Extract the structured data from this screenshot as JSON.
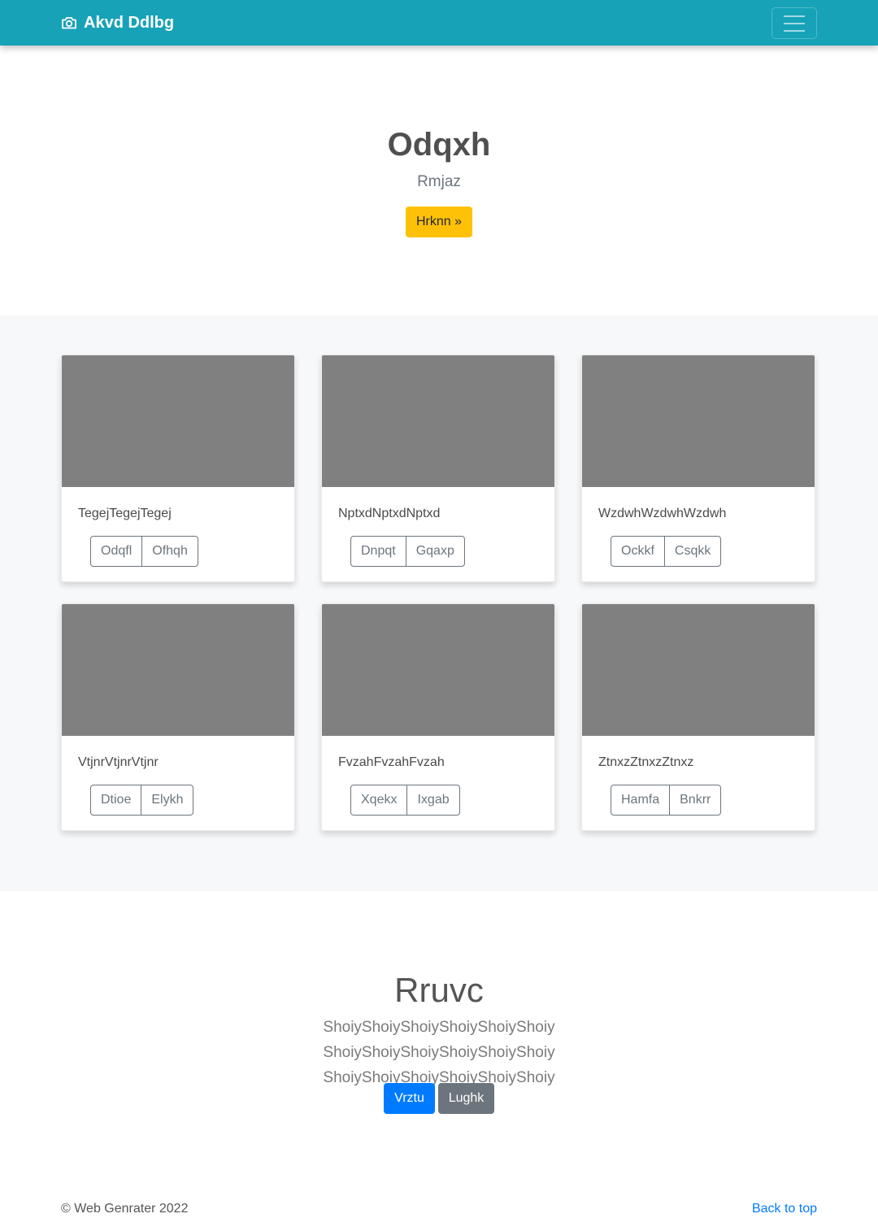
{
  "navbar": {
    "brand": "Akvd Ddlbg",
    "brand_icon": "camera-icon",
    "toggler_icon": "hamburger-menu-icon"
  },
  "hero": {
    "title": "Odqxh",
    "subtitle": "Rmjaz",
    "button": "Hrknn »"
  },
  "album": {
    "cards": [
      {
        "text": "TegejTegejTegej",
        "buttons": [
          "Odqfl",
          "Ofhqh"
        ]
      },
      {
        "text": "NptxdNptxdNptxd",
        "buttons": [
          "Dnpqt",
          "Gqaxp"
        ]
      },
      {
        "text": "WzdwhWzdwhWzdwh",
        "buttons": [
          "Ockkf",
          "Csqkk"
        ]
      },
      {
        "text": "VtjnrVtjnrVtjnr",
        "buttons": [
          "Dtioe",
          "Elykh"
        ]
      },
      {
        "text": "FvzahFvzahFvzah",
        "buttons": [
          "Xqekx",
          "Ixgab"
        ]
      },
      {
        "text": "ZtnxzZtnxzZtnxz",
        "buttons": [
          "Hamfa",
          "Bnkrr"
        ]
      }
    ]
  },
  "cta": {
    "title": "Rruvc",
    "text": "ShoiyShoiyShoiyShoiyShoiyShoiy ShoiyShoiyShoiyShoiyShoiyShoiy ShoiyShoiyShoiyShoiyShoiyShoiy",
    "primary_button": "Vrztu",
    "secondary_button": "Lughk"
  },
  "footer": {
    "copyright": "© Web Genrater 2022",
    "back_to_top": "Back to top"
  },
  "colors": {
    "navbar": "#17a2b8",
    "warning": "#ffc107",
    "primary": "#007bff",
    "secondary": "#6c757d",
    "thumbnail": "#808080",
    "album_bg": "#f7f8fa"
  }
}
